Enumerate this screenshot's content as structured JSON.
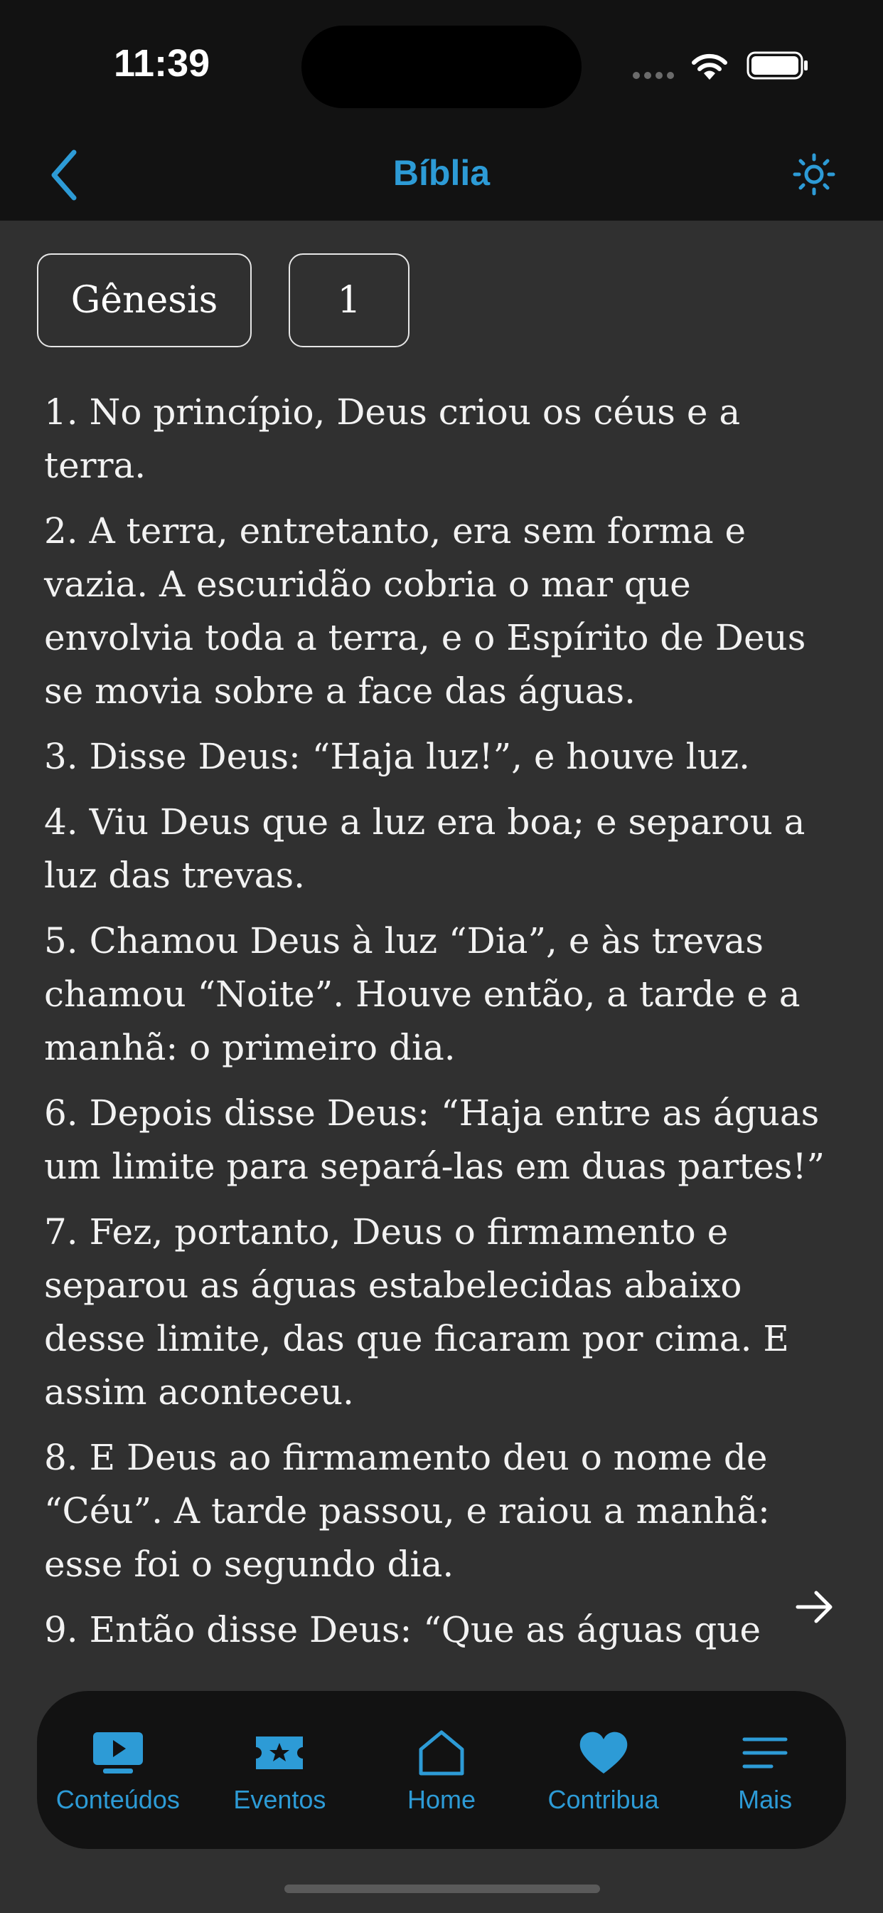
{
  "status": {
    "time": "11:39"
  },
  "nav": {
    "title": "Bíblia"
  },
  "selectors": {
    "book": "Gênesis",
    "chapter": "1"
  },
  "verses": [
    "1. No princípio, Deus criou os céus e a terra.",
    "2. A terra, entretanto, era sem forma e vazia. A escuridão cobria o mar que envolvia toda a terra, e o Espírito de Deus se movia sobre a face das águas.",
    "3. Disse Deus: “Haja luz!”, e houve luz.",
    "4. Viu Deus que a luz era boa; e separou a luz das trevas.",
    "5. Chamou Deus à luz “Dia”, e às trevas chamou “Noite”. Houve então, a tarde e a manhã: o primeiro dia.",
    "6. Depois disse Deus: “Haja entre as águas um limite para separá-las em duas partes!”",
    "7. Fez, portanto, Deus o firmamento e separou as águas estabelecidas abaixo desse limite, das que ficaram por cima. E assim aconteceu.",
    "8. E Deus ao firmamento deu o nome de “Céu”. A tarde passou, e raiou a manhã: esse foi o segundo dia.",
    "9. Então disse Deus: “Que as águas que"
  ],
  "tabs": [
    {
      "label": "Conteúdos",
      "icon": "tv-play-icon"
    },
    {
      "label": "Eventos",
      "icon": "ticket-star-icon"
    },
    {
      "label": "Home",
      "icon": "home-icon"
    },
    {
      "label": "Contribua",
      "icon": "heart-icon"
    },
    {
      "label": "Mais",
      "icon": "menu-icon"
    }
  ],
  "colors": {
    "accent": "#2d9bd6",
    "background": "#303030",
    "bars": "#121212",
    "text": "#f2f2f2"
  }
}
